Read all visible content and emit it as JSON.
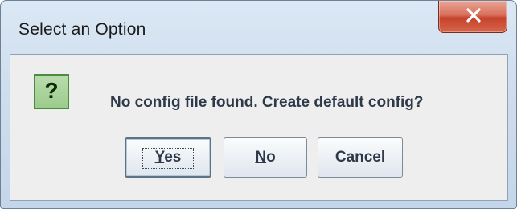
{
  "dialog": {
    "title": "Select an Option",
    "icon": "question-icon",
    "icon_glyph": "?",
    "message": "No config file found. Create default config?",
    "close_icon": "close-icon"
  },
  "buttons": {
    "yes": {
      "mnemonic": "Y",
      "rest": "es"
    },
    "no": {
      "mnemonic": "N",
      "rest": "o"
    },
    "cancel": {
      "label": "Cancel"
    }
  },
  "colors": {
    "titlebar": "#cfdeee",
    "close_button": "#c4432b",
    "icon_bg": "#9ccb8c",
    "text": "#2e3a4a"
  }
}
